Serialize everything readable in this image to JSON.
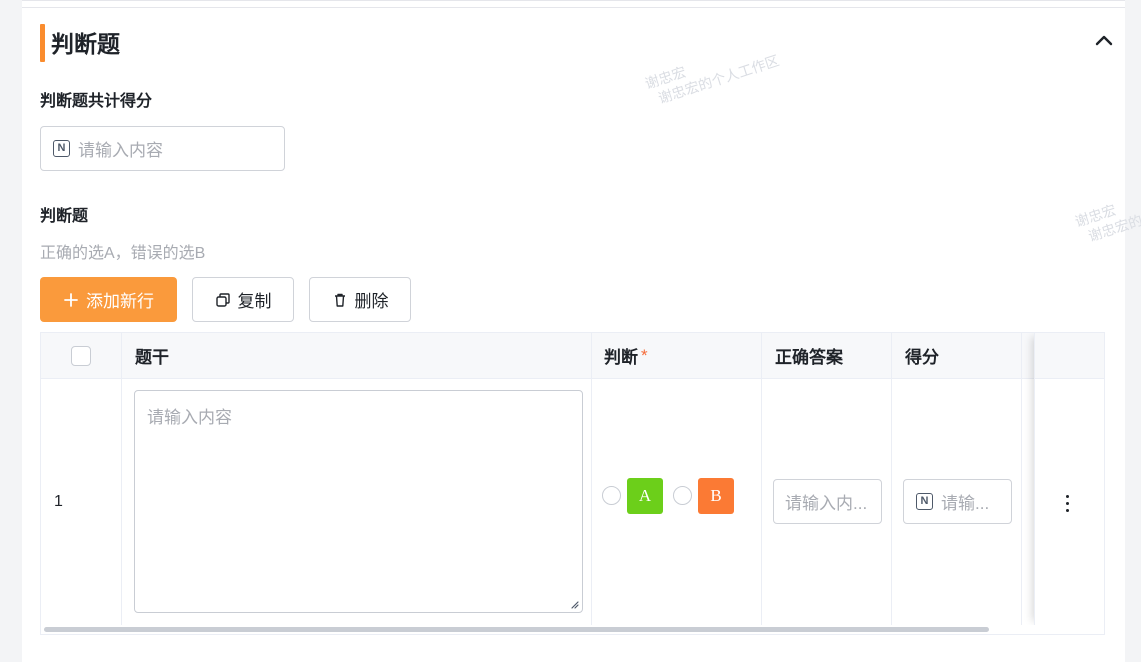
{
  "section": {
    "title": "判断题"
  },
  "total_score": {
    "label": "判断题共计得分",
    "placeholder": "请输入内容"
  },
  "questions": {
    "label": "判断题",
    "hint": "正确的选A，错误的选B",
    "add_label": "添加新行",
    "copy_label": "复制",
    "delete_label": "删除"
  },
  "table": {
    "columns": {
      "stem": "题干",
      "judge": "判断",
      "required_mark": "*",
      "answer": "正确答案",
      "score": "得分"
    },
    "rows": [
      {
        "index": "1",
        "stem_placeholder": "请输入内容",
        "option_a": "A",
        "option_b": "B",
        "answer_placeholder": "请输入内...",
        "score_placeholder": "请输..."
      }
    ]
  },
  "watermark": {
    "line1": "谢忠宏",
    "line2": "谢忠宏的个人工作区"
  },
  "colors": {
    "accent": "#fa9a3c",
    "option_a": "#6ccf1a",
    "option_b": "#fb7a34"
  },
  "icons": [
    "chevron-up-icon",
    "number-icon",
    "plus-icon",
    "copy-icon",
    "trash-icon",
    "more-vertical-icon",
    "resize-grip-icon"
  ]
}
